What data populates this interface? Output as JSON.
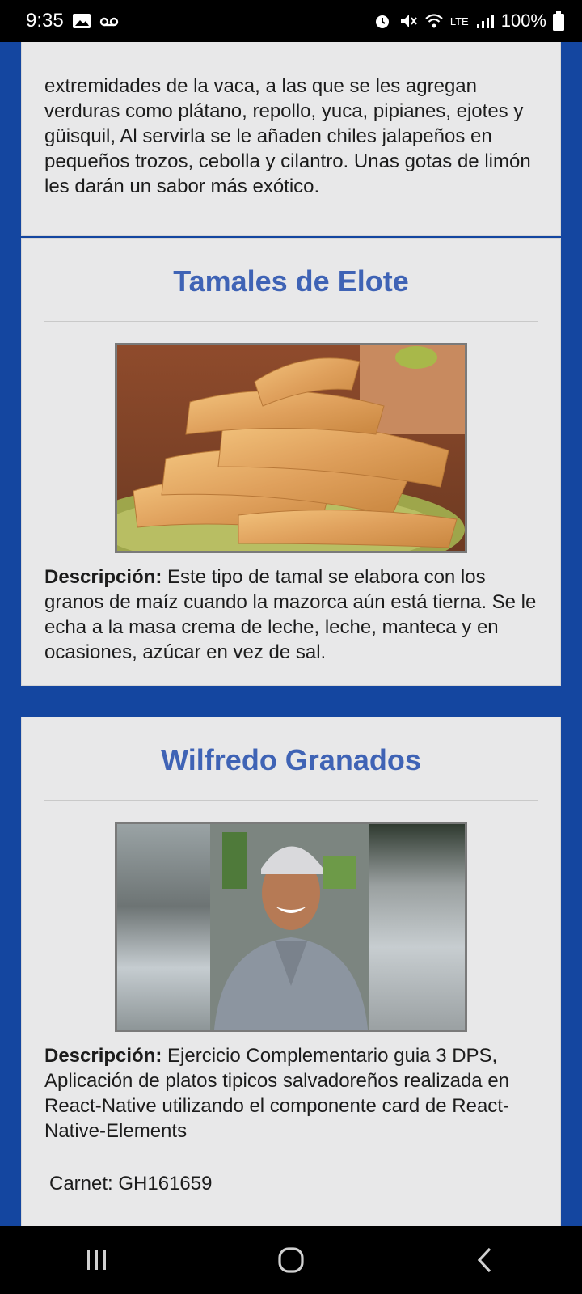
{
  "status_bar": {
    "time": "9:35",
    "battery": "100%",
    "network": "LTE"
  },
  "cards": {
    "previous": {
      "description_tail": "extremidades de la vaca, a las que se les agregan verduras como plátano, repollo, yuca, pipianes, ejotes y güisquil, Al servirla se le añaden chiles jalapeños en pequeños trozos, cebolla y cilantro. Unas gotas de limón les darán un sabor más exótico."
    },
    "tamales": {
      "title": "Tamales de Elote",
      "description_label": "Descripción:",
      "description": " Este tipo de tamal se elabora con los granos de maíz cuando la mazorca aún está tierna. Se le echa a la masa crema de leche, leche, manteca y en ocasiones, azúcar en vez de sal."
    },
    "author": {
      "title": "Wilfredo Granados",
      "description_label": "Descripción:",
      "description": " Ejercicio Complementario guia 3 DPS, Aplicación de platos tipicos salvadoreños realizada en React-Native utilizando el componente card de React-Native-Elements",
      "carnet": "Carnet: GH161659"
    }
  },
  "colors": {
    "background": "#1446A0",
    "card": "#E8E8E9",
    "title": "#3F63B5"
  },
  "icons": {
    "status_left": [
      "gallery-icon",
      "voicemail-icon"
    ],
    "status_right": [
      "alarm-icon",
      "mute-icon",
      "wifi-icon",
      "signal-icon",
      "battery-icon"
    ],
    "nav": [
      "recents-icon",
      "home-icon",
      "back-icon"
    ]
  }
}
